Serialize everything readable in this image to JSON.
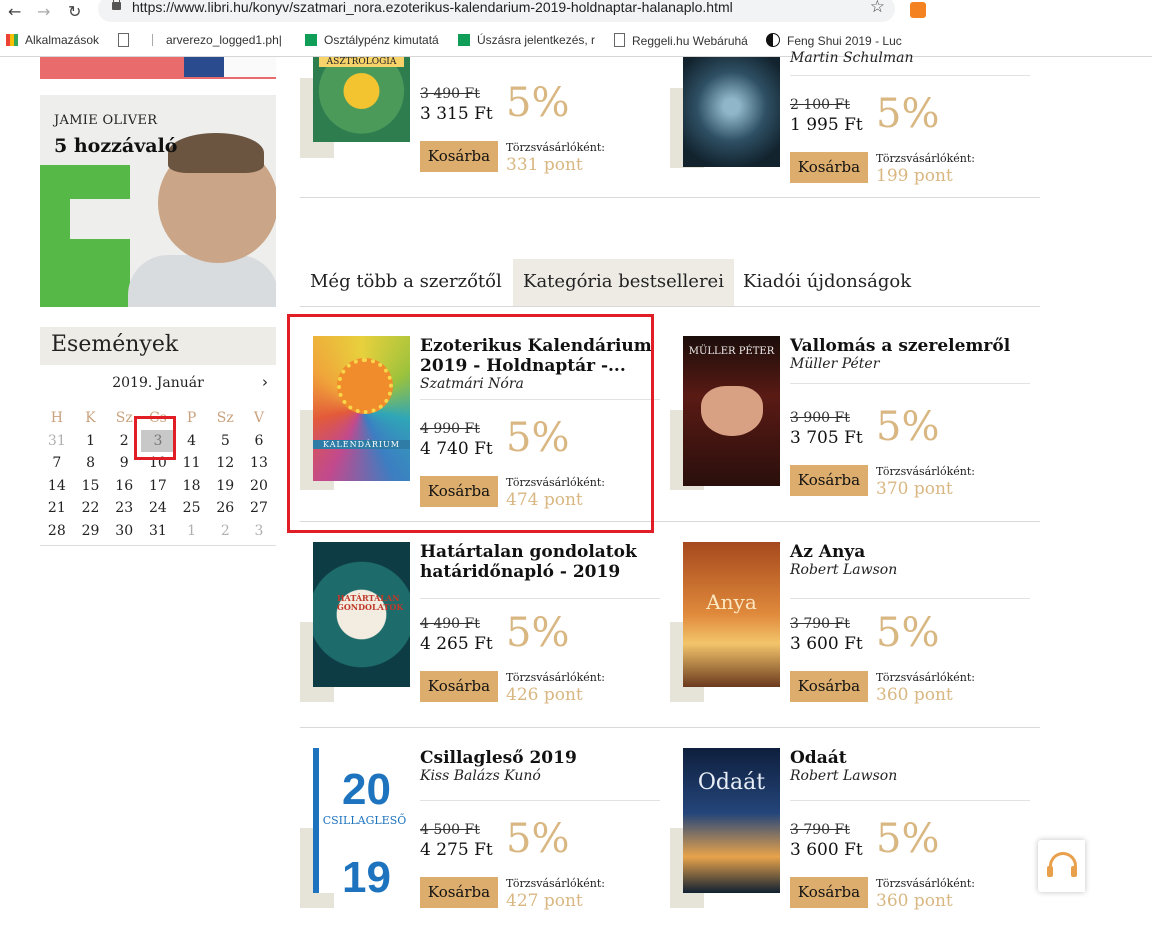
{
  "browser": {
    "url": "https://www.libri.hu/konyv/szatmari_nora.ezoterikus-kalendarium-2019-holdnaptar-halanaplo.html",
    "bookmarks": [
      "Alkalmazások",
      "arverezo_logged1.ph|",
      "Osztálypénz kimutatá",
      "Úszásra jelentkezés, r",
      "Reggeli.hu Webáruhá",
      "Feng Shui 2019 - Luc"
    ]
  },
  "sidebar": {
    "banner_author": "JAMIE OLIVER",
    "banner_title": "5 hozzávaló",
    "events_title": "Események",
    "calendar": {
      "month": "2019. Január",
      "weekdays": [
        "H",
        "K",
        "Sz",
        "Cs",
        "P",
        "Sz",
        "V"
      ],
      "weeks": [
        [
          "31",
          "1",
          "2",
          "3",
          "4",
          "5",
          "6"
        ],
        [
          "7",
          "8",
          "9",
          "10",
          "11",
          "12",
          "13"
        ],
        [
          "14",
          "15",
          "16",
          "17",
          "18",
          "19",
          "20"
        ],
        [
          "21",
          "22",
          "23",
          "24",
          "25",
          "26",
          "27"
        ],
        [
          "28",
          "29",
          "30",
          "31",
          "1",
          "2",
          "3"
        ]
      ],
      "today": "3"
    }
  },
  "top_products": [
    {
      "old_price": "3 490 Ft",
      "price": "3 315 Ft",
      "discount": "5%",
      "button": "Kosárba",
      "loyalty_label": "Törzsvásárlóként:",
      "points": "331 pont",
      "cover_text": "ASZTROLÓGIA"
    },
    {
      "author": "Martin Schulman",
      "old_price": "2 100 Ft",
      "price": "1 995 Ft",
      "discount": "5%",
      "button": "Kosárba",
      "loyalty_label": "Törzsvásárlóként:",
      "points": "199 pont"
    }
  ],
  "tabs": [
    "Még több a szerzőtől",
    "Kategória bestsellerei",
    "Kiadói újdonságok"
  ],
  "products": [
    {
      "title": "Ezoterikus Kalendárium 2019 - Holdnaptár -...",
      "author": "Szatmári Nóra",
      "old_price": "4 990 Ft",
      "price": "4 740 Ft",
      "discount": "5%",
      "button": "Kosárba",
      "loyalty_label": "Törzsvásárlóként:",
      "points": "474 pont",
      "cover_text": "KALENDÁRIUM"
    },
    {
      "title": "Vallomás a szerelemről",
      "author": "Müller Péter",
      "old_price": "3 900 Ft",
      "price": "3 705 Ft",
      "discount": "5%",
      "button": "Kosárba",
      "loyalty_label": "Törzsvásárlóként:",
      "points": "370 pont",
      "cover_text": "MÜLLER PÉTER"
    },
    {
      "title": "Határtalan gondolatok határidőnapló - 2019",
      "author": "",
      "old_price": "4 490 Ft",
      "price": "4 265 Ft",
      "discount": "5%",
      "button": "Kosárba",
      "loyalty_label": "Törzsvásárlóként:",
      "points": "426 pont",
      "cover_text": "HATÁRTALAN GONDOLATOK"
    },
    {
      "title": "Az Anya",
      "author": "Robert Lawson",
      "old_price": "3 790 Ft",
      "price": "3 600 Ft",
      "discount": "5%",
      "button": "Kosárba",
      "loyalty_label": "Törzsvásárlóként:",
      "points": "360 pont",
      "cover_text": "Anya"
    },
    {
      "title": "Csillagleső 2019",
      "author": "Kiss Balázs Kunó",
      "old_price": "4 500 Ft",
      "price": "4 275 Ft",
      "discount": "5%",
      "button": "Kosárba",
      "loyalty_label": "Törzsvásárlóként:",
      "points": "427 pont",
      "cover_text": "CSILLAGLESŐ"
    },
    {
      "title": "Odaát",
      "author": "Robert Lawson",
      "old_price": "3 790 Ft",
      "price": "3 600 Ft",
      "discount": "5%",
      "button": "Kosárba",
      "loyalty_label": "Törzsvásárlóként:",
      "points": "360 pont",
      "cover_text": "Odaát"
    }
  ]
}
